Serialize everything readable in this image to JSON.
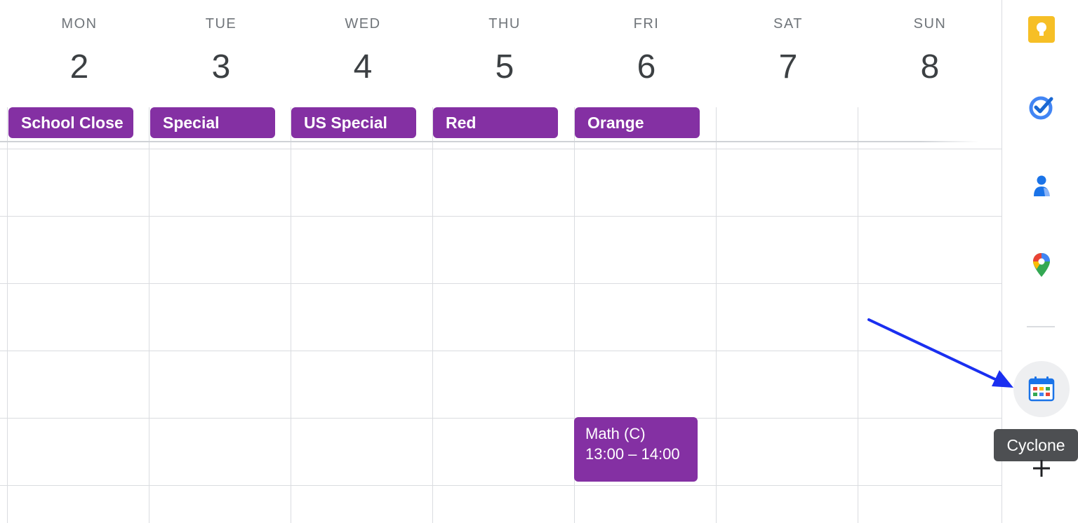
{
  "days": [
    {
      "dow": "MON",
      "num": "2"
    },
    {
      "dow": "TUE",
      "num": "3"
    },
    {
      "dow": "WED",
      "num": "4"
    },
    {
      "dow": "THU",
      "num": "5"
    },
    {
      "dow": "FRI",
      "num": "6"
    },
    {
      "dow": "SAT",
      "num": "7"
    },
    {
      "dow": "SUN",
      "num": "8"
    }
  ],
  "allday_events": [
    "School Close",
    "Special",
    "US Special",
    "Red",
    "Orange"
  ],
  "timed_event": {
    "title": "Math (C)",
    "time": "13:00 – 14:00"
  },
  "sidebar": {
    "icons": [
      "keep-icon",
      "tasks-icon",
      "contacts-icon",
      "maps-icon",
      "cyclone-addon-icon",
      "add-icon"
    ],
    "tooltip": "Cyclone"
  },
  "colors": {
    "event": "#8430a3",
    "arrow": "#1a2ff0",
    "grid": "#dadce0"
  }
}
